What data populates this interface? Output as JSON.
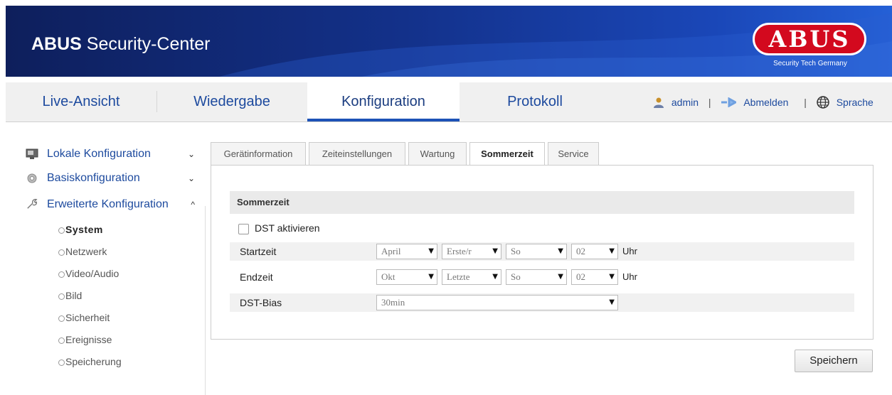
{
  "header": {
    "title_bold": "ABUS",
    "title_rest": " Security-Center",
    "logo_text": "ABUS",
    "logo_sub": "Security Tech Germany"
  },
  "nav": {
    "tabs": [
      {
        "label": "Live-Ansicht"
      },
      {
        "label": "Wiedergabe"
      },
      {
        "label": "Konfiguration",
        "active": true
      },
      {
        "label": "Protokoll"
      }
    ],
    "user": "admin",
    "logout": "Abmelden",
    "language": "Sprache",
    "separator": "|"
  },
  "sidebar": {
    "groups": [
      {
        "label": "Lokale Konfiguration",
        "caret": "⌄"
      },
      {
        "label": "Basiskonfiguration",
        "caret": "⌄"
      },
      {
        "label": "Erweiterte Konfiguration",
        "caret": "^"
      }
    ],
    "items": [
      {
        "label": "System",
        "active": true
      },
      {
        "label": "Netzwerk"
      },
      {
        "label": "Video/Audio"
      },
      {
        "label": "Bild"
      },
      {
        "label": "Sicherheit"
      },
      {
        "label": "Ereignisse"
      },
      {
        "label": "Speicherung"
      }
    ]
  },
  "content_tabs": [
    {
      "label": "Gerätinformation"
    },
    {
      "label": "Zeiteinstellungen"
    },
    {
      "label": "Wartung"
    },
    {
      "label": "Sommerzeit",
      "active": true
    },
    {
      "label": "Service"
    }
  ],
  "panel": {
    "section_title": "Sommerzeit",
    "dst_label": "DST aktivieren",
    "dst_checked": false,
    "start": {
      "label": "Startzeit",
      "month": "April",
      "week": "Erste/r",
      "day": "So",
      "hour": "02",
      "unit": "Uhr"
    },
    "end": {
      "label": "Endzeit",
      "month": "Okt",
      "week": "Letzte",
      "day": "So",
      "hour": "02",
      "unit": "Uhr"
    },
    "bias": {
      "label": "DST-Bias",
      "value": "30min"
    }
  },
  "save_label": "Speichern",
  "dropdown_arrow": "▼",
  "colors": {
    "accent": "#1d4a9e",
    "logo_red": "#d3091e",
    "header_blue": "#13318a"
  }
}
